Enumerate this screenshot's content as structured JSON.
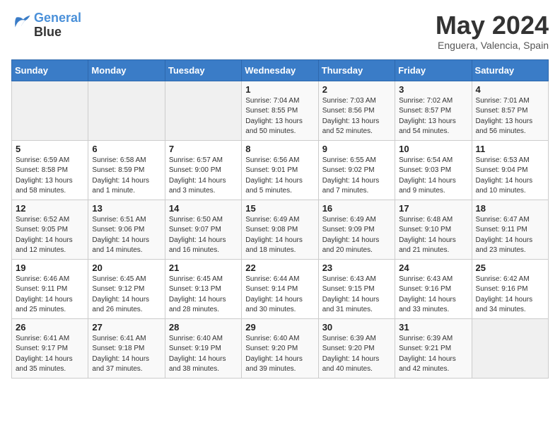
{
  "logo": {
    "line1": "General",
    "line2": "Blue"
  },
  "title": "May 2024",
  "location": "Enguera, Valencia, Spain",
  "days_of_week": [
    "Sunday",
    "Monday",
    "Tuesday",
    "Wednesday",
    "Thursday",
    "Friday",
    "Saturday"
  ],
  "weeks": [
    [
      {
        "day": "",
        "sunrise": "",
        "sunset": "",
        "daylight": ""
      },
      {
        "day": "",
        "sunrise": "",
        "sunset": "",
        "daylight": ""
      },
      {
        "day": "",
        "sunrise": "",
        "sunset": "",
        "daylight": ""
      },
      {
        "day": "1",
        "sunrise": "Sunrise: 7:04 AM",
        "sunset": "Sunset: 8:55 PM",
        "daylight": "Daylight: 13 hours and 50 minutes."
      },
      {
        "day": "2",
        "sunrise": "Sunrise: 7:03 AM",
        "sunset": "Sunset: 8:56 PM",
        "daylight": "Daylight: 13 hours and 52 minutes."
      },
      {
        "day": "3",
        "sunrise": "Sunrise: 7:02 AM",
        "sunset": "Sunset: 8:57 PM",
        "daylight": "Daylight: 13 hours and 54 minutes."
      },
      {
        "day": "4",
        "sunrise": "Sunrise: 7:01 AM",
        "sunset": "Sunset: 8:57 PM",
        "daylight": "Daylight: 13 hours and 56 minutes."
      }
    ],
    [
      {
        "day": "5",
        "sunrise": "Sunrise: 6:59 AM",
        "sunset": "Sunset: 8:58 PM",
        "daylight": "Daylight: 13 hours and 58 minutes."
      },
      {
        "day": "6",
        "sunrise": "Sunrise: 6:58 AM",
        "sunset": "Sunset: 8:59 PM",
        "daylight": "Daylight: 14 hours and 1 minute."
      },
      {
        "day": "7",
        "sunrise": "Sunrise: 6:57 AM",
        "sunset": "Sunset: 9:00 PM",
        "daylight": "Daylight: 14 hours and 3 minutes."
      },
      {
        "day": "8",
        "sunrise": "Sunrise: 6:56 AM",
        "sunset": "Sunset: 9:01 PM",
        "daylight": "Daylight: 14 hours and 5 minutes."
      },
      {
        "day": "9",
        "sunrise": "Sunrise: 6:55 AM",
        "sunset": "Sunset: 9:02 PM",
        "daylight": "Daylight: 14 hours and 7 minutes."
      },
      {
        "day": "10",
        "sunrise": "Sunrise: 6:54 AM",
        "sunset": "Sunset: 9:03 PM",
        "daylight": "Daylight: 14 hours and 9 minutes."
      },
      {
        "day": "11",
        "sunrise": "Sunrise: 6:53 AM",
        "sunset": "Sunset: 9:04 PM",
        "daylight": "Daylight: 14 hours and 10 minutes."
      }
    ],
    [
      {
        "day": "12",
        "sunrise": "Sunrise: 6:52 AM",
        "sunset": "Sunset: 9:05 PM",
        "daylight": "Daylight: 14 hours and 12 minutes."
      },
      {
        "day": "13",
        "sunrise": "Sunrise: 6:51 AM",
        "sunset": "Sunset: 9:06 PM",
        "daylight": "Daylight: 14 hours and 14 minutes."
      },
      {
        "day": "14",
        "sunrise": "Sunrise: 6:50 AM",
        "sunset": "Sunset: 9:07 PM",
        "daylight": "Daylight: 14 hours and 16 minutes."
      },
      {
        "day": "15",
        "sunrise": "Sunrise: 6:49 AM",
        "sunset": "Sunset: 9:08 PM",
        "daylight": "Daylight: 14 hours and 18 minutes."
      },
      {
        "day": "16",
        "sunrise": "Sunrise: 6:49 AM",
        "sunset": "Sunset: 9:09 PM",
        "daylight": "Daylight: 14 hours and 20 minutes."
      },
      {
        "day": "17",
        "sunrise": "Sunrise: 6:48 AM",
        "sunset": "Sunset: 9:10 PM",
        "daylight": "Daylight: 14 hours and 21 minutes."
      },
      {
        "day": "18",
        "sunrise": "Sunrise: 6:47 AM",
        "sunset": "Sunset: 9:11 PM",
        "daylight": "Daylight: 14 hours and 23 minutes."
      }
    ],
    [
      {
        "day": "19",
        "sunrise": "Sunrise: 6:46 AM",
        "sunset": "Sunset: 9:11 PM",
        "daylight": "Daylight: 14 hours and 25 minutes."
      },
      {
        "day": "20",
        "sunrise": "Sunrise: 6:45 AM",
        "sunset": "Sunset: 9:12 PM",
        "daylight": "Daylight: 14 hours and 26 minutes."
      },
      {
        "day": "21",
        "sunrise": "Sunrise: 6:45 AM",
        "sunset": "Sunset: 9:13 PM",
        "daylight": "Daylight: 14 hours and 28 minutes."
      },
      {
        "day": "22",
        "sunrise": "Sunrise: 6:44 AM",
        "sunset": "Sunset: 9:14 PM",
        "daylight": "Daylight: 14 hours and 30 minutes."
      },
      {
        "day": "23",
        "sunrise": "Sunrise: 6:43 AM",
        "sunset": "Sunset: 9:15 PM",
        "daylight": "Daylight: 14 hours and 31 minutes."
      },
      {
        "day": "24",
        "sunrise": "Sunrise: 6:43 AM",
        "sunset": "Sunset: 9:16 PM",
        "daylight": "Daylight: 14 hours and 33 minutes."
      },
      {
        "day": "25",
        "sunrise": "Sunrise: 6:42 AM",
        "sunset": "Sunset: 9:16 PM",
        "daylight": "Daylight: 14 hours and 34 minutes."
      }
    ],
    [
      {
        "day": "26",
        "sunrise": "Sunrise: 6:41 AM",
        "sunset": "Sunset: 9:17 PM",
        "daylight": "Daylight: 14 hours and 35 minutes."
      },
      {
        "day": "27",
        "sunrise": "Sunrise: 6:41 AM",
        "sunset": "Sunset: 9:18 PM",
        "daylight": "Daylight: 14 hours and 37 minutes."
      },
      {
        "day": "28",
        "sunrise": "Sunrise: 6:40 AM",
        "sunset": "Sunset: 9:19 PM",
        "daylight": "Daylight: 14 hours and 38 minutes."
      },
      {
        "day": "29",
        "sunrise": "Sunrise: 6:40 AM",
        "sunset": "Sunset: 9:20 PM",
        "daylight": "Daylight: 14 hours and 39 minutes."
      },
      {
        "day": "30",
        "sunrise": "Sunrise: 6:39 AM",
        "sunset": "Sunset: 9:20 PM",
        "daylight": "Daylight: 14 hours and 40 minutes."
      },
      {
        "day": "31",
        "sunrise": "Sunrise: 6:39 AM",
        "sunset": "Sunset: 9:21 PM",
        "daylight": "Daylight: 14 hours and 42 minutes."
      },
      {
        "day": "",
        "sunrise": "",
        "sunset": "",
        "daylight": ""
      }
    ]
  ]
}
